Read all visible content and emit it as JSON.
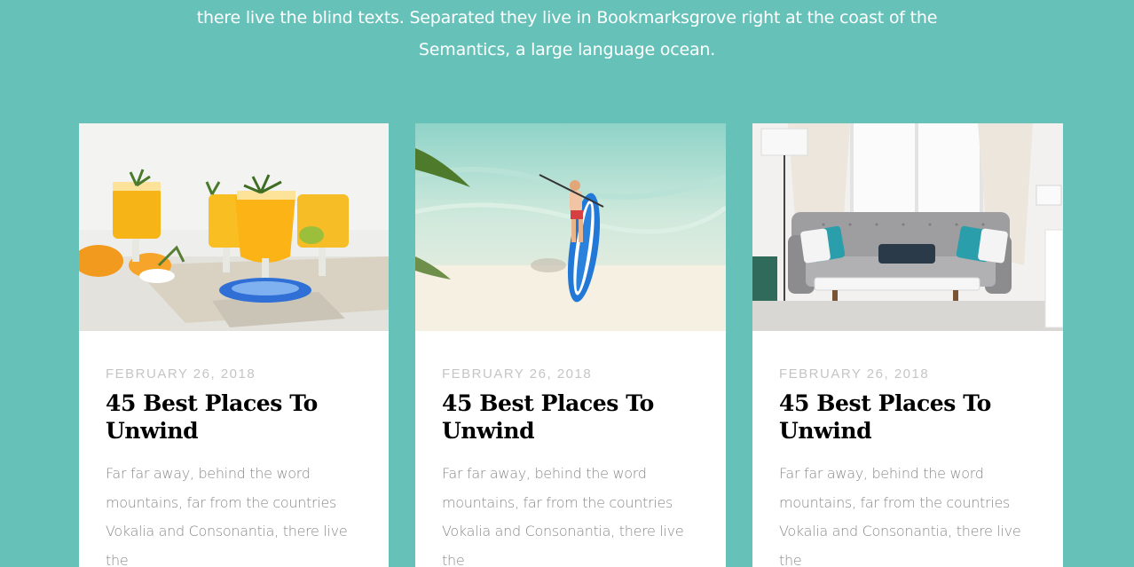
{
  "intro": {
    "line1": "there live the blind texts. Separated they live in Bookmarksgrove right at the coast of the",
    "line2": "Semantics, a large language ocean."
  },
  "posts": [
    {
      "image": "orange-cocktails-photo",
      "date": "FEBRUARY 26, 2018",
      "title": "45 Best Places To Unwind",
      "excerpt": "Far far away, behind the word mountains, far from the countries Vokalia and Consonantia, there live the"
    },
    {
      "image": "paddleboard-beach-photo",
      "date": "FEBRUARY 26, 2018",
      "title": "45 Best Places To Unwind",
      "excerpt": "Far far away, behind the word mountains, far from the countries Vokalia and Consonantia, there live the"
    },
    {
      "image": "living-room-sofa-photo",
      "date": "FEBRUARY 26, 2018",
      "title": "45 Best Places To Unwind",
      "excerpt": "Far far away, behind the word mountains, far from the countries Vokalia and Consonantia, there live the"
    }
  ],
  "colors": {
    "background": "#66c2b9",
    "card": "#ffffff",
    "date": "#c5c5c5",
    "title": "#000000",
    "excerpt": "#8a8a8a"
  }
}
